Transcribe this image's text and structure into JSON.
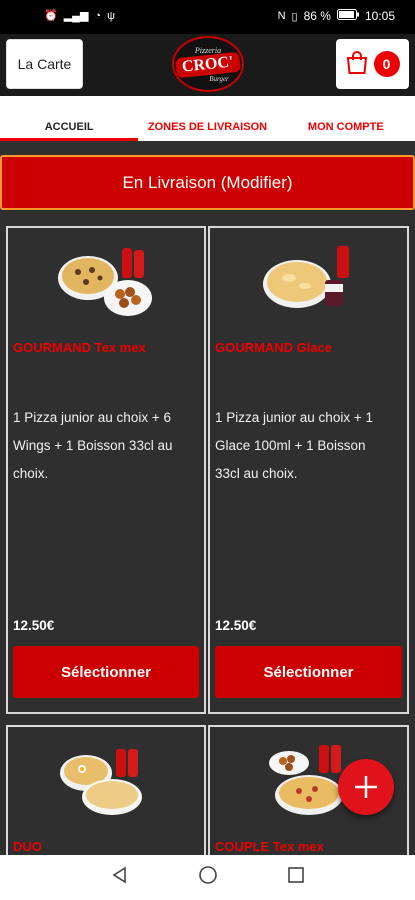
{
  "status_bar": {
    "battery": "86 %",
    "time": "10:05"
  },
  "header": {
    "menu_label": "La Carte",
    "logo_top": "Pizzeria",
    "logo_main": "CROC'",
    "logo_bottom": "Burger",
    "cart_count": "0"
  },
  "tabs": [
    {
      "label": "ACCUEIL",
      "active": true
    },
    {
      "label": "ZONES DE LIVRAISON",
      "active": false
    },
    {
      "label": "MON COMPTE",
      "active": false
    }
  ],
  "delivery_button": "En Livraison (Modifier)",
  "products": [
    {
      "title": "GOURMAND Tex mex",
      "description": "1 Pizza junior au choix + 6 Wings + 1 Boisson 33cl au choix.",
      "price": "12.50€",
      "button": "Sélectionner"
    },
    {
      "title": "GOURMAND Glace",
      "description": "1 Pizza junior au choix + 1 Glace 100ml + 1 Boisson 33cl au choix.",
      "price": "12.50€",
      "button": "Sélectionner"
    },
    {
      "title": "DUO"
    },
    {
      "title": "COUPLE Tex mex"
    }
  ],
  "colors": {
    "accent": "#cc0000",
    "background": "#2f2f2f",
    "header": "#1a1a1a",
    "border_highlight": "#ff9a2a"
  },
  "icons": [
    "alarm-icon",
    "signal-icon",
    "wifi-icon",
    "usb-icon",
    "nfc-icon",
    "vibrate-icon",
    "battery-icon",
    "cart-icon",
    "plus-icon",
    "back-icon",
    "home-icon",
    "recents-icon"
  ]
}
